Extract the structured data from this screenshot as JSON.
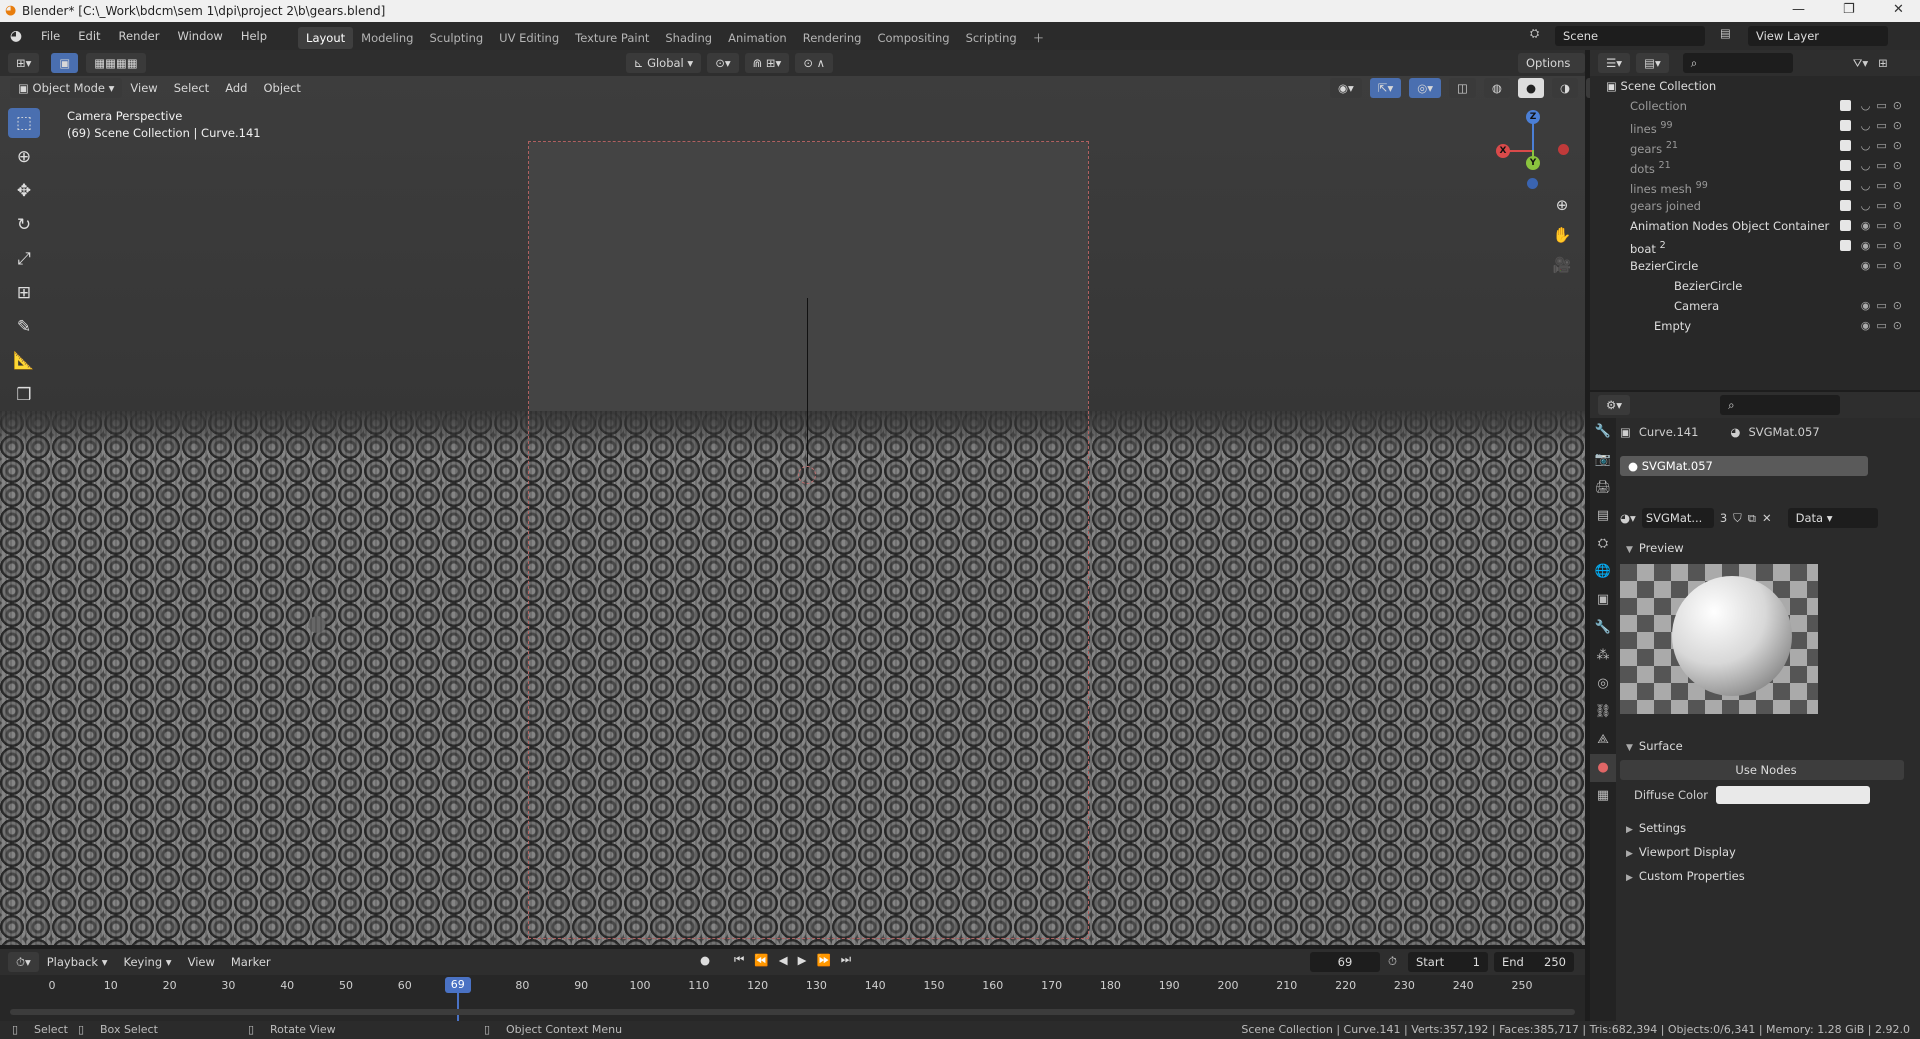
{
  "window": {
    "title": "Blender* [C:\\_Work\\bdcm\\sem 1\\dpi\\project 2\\b\\gears.blend]"
  },
  "menubar": {
    "items": [
      "File",
      "Edit",
      "Render",
      "Window",
      "Help"
    ]
  },
  "workspaces": [
    "Layout",
    "Modeling",
    "Sculpting",
    "UV Editing",
    "Texture Paint",
    "Shading",
    "Animation",
    "Rendering",
    "Compositing",
    "Scripting"
  ],
  "active_workspace": "Layout",
  "scene": {
    "label": "Scene",
    "view_layer": "View Layer"
  },
  "viewport_header": {
    "transform_orientation": "Global",
    "options": "Options"
  },
  "viewport_menu": {
    "mode": "Object Mode",
    "items": [
      "View",
      "Select",
      "Add",
      "Object"
    ]
  },
  "viewport_info": {
    "line1": "Camera Perspective",
    "line2": "(69) Scene Collection | Curve.141"
  },
  "gizmo": {
    "x": "X",
    "y": "Y",
    "z": "Z"
  },
  "outliner": {
    "root": "Scene Collection",
    "items": [
      {
        "name": "Collection",
        "badge": ""
      },
      {
        "name": "lines",
        "badge": "99"
      },
      {
        "name": "gears",
        "badge": "21"
      },
      {
        "name": "dots",
        "badge": "21"
      },
      {
        "name": "lines mesh",
        "badge": "99"
      },
      {
        "name": "gears joined",
        "badge": ""
      },
      {
        "name": "Animation Nodes Object Container",
        "badge": ""
      },
      {
        "name": "boat",
        "badge": "2"
      },
      {
        "name": "BezierCircle",
        "badge": ""
      },
      {
        "name": "BezierCircle",
        "badge": ""
      },
      {
        "name": "Camera",
        "badge": ""
      },
      {
        "name": "Empty",
        "badge": ""
      }
    ]
  },
  "properties": {
    "object": "Curve.141",
    "material": "SVGMat.057",
    "slot": "SVGMat.057",
    "mat_field": "SVGMat...",
    "users": "3",
    "link": "Data",
    "panels": {
      "preview": "Preview",
      "surface": "Surface",
      "settings": "Settings",
      "viewport_display": "Viewport Display",
      "custom_properties": "Custom Properties"
    },
    "use_nodes": "Use Nodes",
    "diffuse_label": "Diffuse Color"
  },
  "timeline": {
    "menus": [
      "Playback",
      "Keying",
      "View",
      "Marker"
    ],
    "current_frame": "69",
    "start_label": "Start",
    "start": "1",
    "end_label": "End",
    "end": "250",
    "ticks": [
      "0",
      "10",
      "20",
      "30",
      "40",
      "50",
      "60",
      "80",
      "90",
      "100",
      "110",
      "120",
      "130",
      "140",
      "150",
      "160",
      "170",
      "180",
      "190",
      "200",
      "210",
      "220",
      "230",
      "240",
      "250"
    ]
  },
  "statusbar": {
    "select": "Select",
    "box_select": "Box Select",
    "rotate": "Rotate View",
    "context": "Object Context Menu",
    "stats": "Scene Collection | Curve.141 | Verts:357,192 | Faces:385,717 | Tris:682,394 | Objects:0/6,341 | Memory: 1.28 GiB | 2.92.0"
  }
}
